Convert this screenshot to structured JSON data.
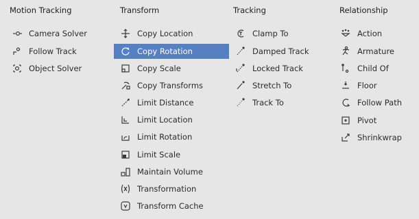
{
  "columns": [
    {
      "header": "Motion Tracking",
      "items": [
        {
          "label": "Camera Solver",
          "icon": "camera-solver-icon",
          "selected": false
        },
        {
          "label": "Follow Track",
          "icon": "follow-track-icon",
          "selected": false
        },
        {
          "label": "Object Solver",
          "icon": "object-solver-icon",
          "selected": false
        }
      ]
    },
    {
      "header": "Transform",
      "items": [
        {
          "label": "Copy Location",
          "icon": "copy-location-icon",
          "selected": false
        },
        {
          "label": "Copy Rotation",
          "icon": "copy-rotation-icon",
          "selected": true
        },
        {
          "label": "Copy Scale",
          "icon": "copy-scale-icon",
          "selected": false
        },
        {
          "label": "Copy Transforms",
          "icon": "copy-transforms-icon",
          "selected": false
        },
        {
          "label": "Limit Distance",
          "icon": "limit-distance-icon",
          "selected": false
        },
        {
          "label": "Limit Location",
          "icon": "limit-location-icon",
          "selected": false
        },
        {
          "label": "Limit Rotation",
          "icon": "limit-rotation-icon",
          "selected": false
        },
        {
          "label": "Limit Scale",
          "icon": "limit-scale-icon",
          "selected": false
        },
        {
          "label": "Maintain Volume",
          "icon": "maintain-volume-icon",
          "selected": false
        },
        {
          "label": "Transformation",
          "icon": "transformation-icon",
          "selected": false
        },
        {
          "label": "Transform Cache",
          "icon": "transform-cache-icon",
          "selected": false
        }
      ]
    },
    {
      "header": "Tracking",
      "items": [
        {
          "label": "Clamp To",
          "icon": "clamp-to-icon",
          "selected": false
        },
        {
          "label": "Damped Track",
          "icon": "damped-track-icon",
          "selected": false
        },
        {
          "label": "Locked Track",
          "icon": "locked-track-icon",
          "selected": false
        },
        {
          "label": "Stretch To",
          "icon": "stretch-to-icon",
          "selected": false
        },
        {
          "label": "Track To",
          "icon": "track-to-icon",
          "selected": false
        }
      ]
    },
    {
      "header": "Relationship",
      "items": [
        {
          "label": "Action",
          "icon": "action-icon",
          "selected": false
        },
        {
          "label": "Armature",
          "icon": "armature-icon",
          "selected": false
        },
        {
          "label": "Child Of",
          "icon": "child-of-icon",
          "selected": false
        },
        {
          "label": "Floor",
          "icon": "floor-icon",
          "selected": false
        },
        {
          "label": "Follow Path",
          "icon": "follow-path-icon",
          "selected": false
        },
        {
          "label": "Pivot",
          "icon": "pivot-icon",
          "selected": false
        },
        {
          "label": "Shrinkwrap",
          "icon": "shrinkwrap-icon",
          "selected": false
        }
      ]
    }
  ],
  "colors": {
    "background": "#e6e6e6",
    "selected_background": "#5680c2",
    "selected_text": "#ffffff",
    "text": "#2b2b2b"
  }
}
